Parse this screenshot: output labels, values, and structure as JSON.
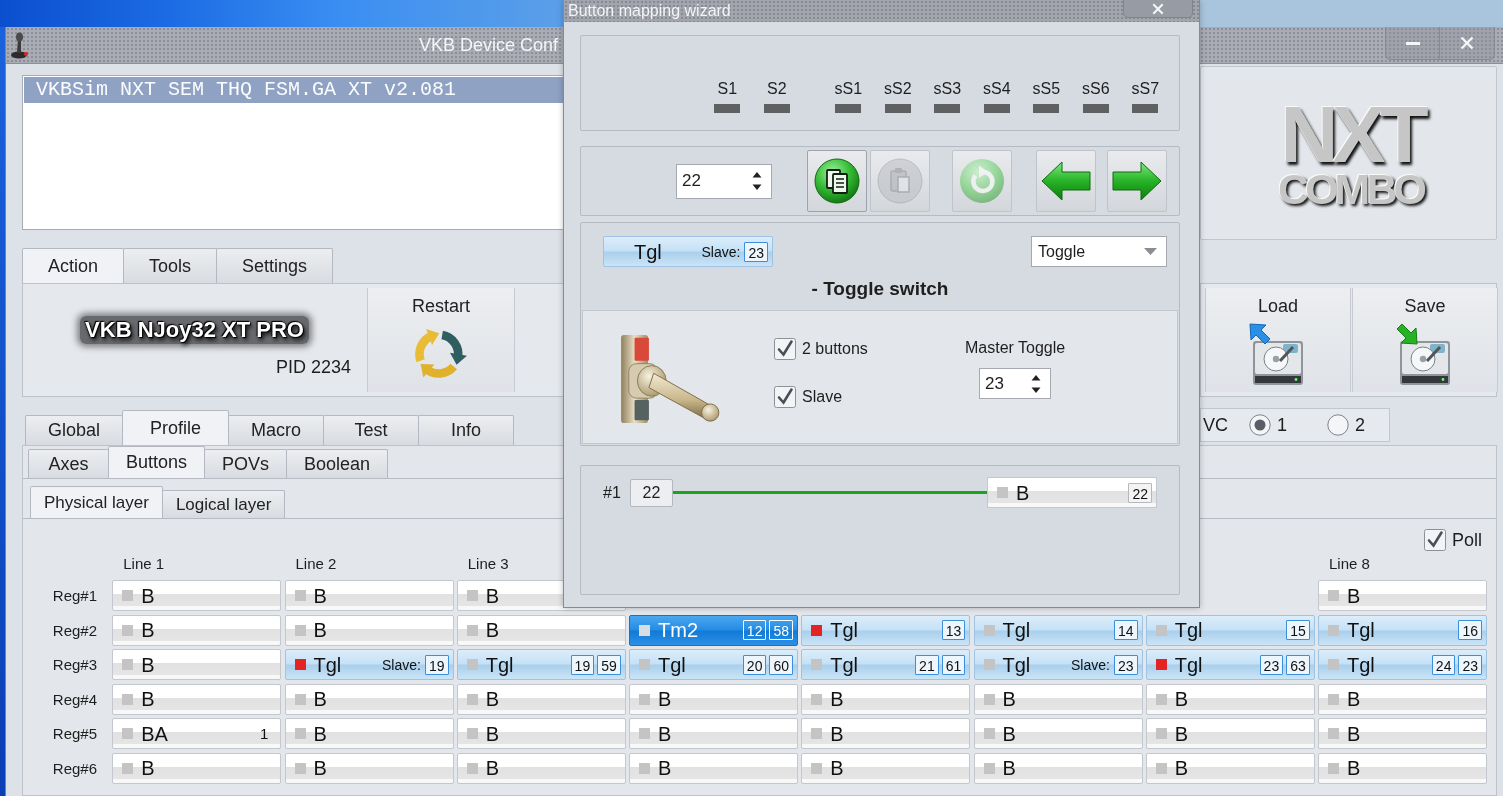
{
  "main_window": {
    "title": "VKB Device Conf"
  },
  "device_list": {
    "items": [
      {
        "label": "VKBSim NXT SEM THQ FSM.GA XT v2.081",
        "selected": true
      }
    ]
  },
  "logo": {
    "title": "NXT",
    "subtitle": "COMBO"
  },
  "action_tabs": [
    {
      "label": "Action",
      "selected": true
    },
    {
      "label": "Tools",
      "selected": false
    },
    {
      "label": "Settings",
      "selected": false
    }
  ],
  "action_panel": {
    "device_name": "VKB NJoy32 XT PRO",
    "pid": "PID 2234",
    "buttons": [
      {
        "kind": "restart",
        "label": "Restart"
      }
    ],
    "file_buttons": [
      {
        "kind": "load",
        "label": "Load"
      },
      {
        "kind": "save",
        "label": "Save"
      }
    ]
  },
  "profile_tabs": [
    {
      "label": "Global",
      "selected": false
    },
    {
      "label": "Profile",
      "selected": true
    },
    {
      "label": "Macro",
      "selected": false
    },
    {
      "label": "Test",
      "selected": false
    },
    {
      "label": "Info",
      "selected": false
    }
  ],
  "vc_group": {
    "label": "VC",
    "options": [
      {
        "label": "1",
        "selected": true
      },
      {
        "label": "2",
        "selected": false
      }
    ]
  },
  "profile_subtabs": [
    {
      "label": "Axes",
      "selected": false
    },
    {
      "label": "Buttons",
      "selected": true
    },
    {
      "label": "POVs",
      "selected": false
    },
    {
      "label": "Boolean",
      "selected": false
    }
  ],
  "layer_tabs": [
    {
      "label": "Physical layer",
      "selected": true
    },
    {
      "label": "Logical layer",
      "selected": false
    }
  ],
  "grid": {
    "poll": {
      "label": "Poll",
      "checked": true
    },
    "columns": [
      {
        "kind": "header",
        "label": "Line 1"
      },
      {
        "kind": "header",
        "label": "Line 2"
      },
      {
        "kind": "header",
        "label": "Line 3"
      },
      {
        "kind": "covered"
      },
      {
        "kind": "covered"
      },
      {
        "kind": "covered"
      },
      {
        "kind": "covered"
      },
      {
        "kind": "header",
        "label": "Line 8"
      }
    ],
    "rows": [
      {
        "label": "Reg#1",
        "cells": [
          {
            "kind": "plain",
            "label": "B",
            "on": false
          },
          {
            "kind": "plain",
            "label": "B",
            "on": false
          },
          {
            "kind": "plain",
            "label": "B",
            "on": false
          },
          {
            "kind": "covered"
          },
          {
            "kind": "covered"
          },
          {
            "kind": "covered"
          },
          {
            "kind": "covered"
          },
          {
            "kind": "plain",
            "label": "B",
            "on": false
          }
        ]
      },
      {
        "label": "Reg#2",
        "cells": [
          {
            "kind": "plain",
            "label": "B",
            "on": false
          },
          {
            "kind": "plain",
            "label": "B",
            "on": false
          },
          {
            "kind": "plain",
            "label": "B",
            "on": false
          },
          {
            "kind": "tempo",
            "label": "Tm2",
            "on": false,
            "numbers": [
              "12",
              "58"
            ]
          },
          {
            "kind": "toggle",
            "label": "Tgl",
            "on": true,
            "numbers": [
              "13"
            ]
          },
          {
            "kind": "toggle",
            "label": "Tgl",
            "on": false,
            "numbers": [
              "14"
            ]
          },
          {
            "kind": "toggle",
            "label": "Tgl",
            "on": false,
            "numbers": [
              "15"
            ]
          },
          {
            "kind": "toggle",
            "label": "Tgl",
            "on": false,
            "numbers": [
              "16"
            ]
          }
        ]
      },
      {
        "label": "Reg#3",
        "cells": [
          {
            "kind": "plain",
            "label": "B",
            "on": false
          },
          {
            "kind": "toggle",
            "label": "Tgl",
            "on": true,
            "tag": "Slave:",
            "numbers": [
              "19"
            ]
          },
          {
            "kind": "toggle",
            "label": "Tgl",
            "on": false,
            "numbers": [
              "19",
              "59"
            ]
          },
          {
            "kind": "toggle",
            "label": "Tgl",
            "on": false,
            "numbers": [
              "20",
              "60"
            ]
          },
          {
            "kind": "toggle",
            "label": "Tgl",
            "on": false,
            "numbers": [
              "21",
              "61"
            ]
          },
          {
            "kind": "toggle",
            "label": "Tgl",
            "on": false,
            "tag": "Slave:",
            "numbers": [
              "23"
            ]
          },
          {
            "kind": "toggle",
            "label": "Tgl",
            "on": true,
            "numbers": [
              "23",
              "63"
            ]
          },
          {
            "kind": "toggle",
            "label": "Tgl",
            "on": false,
            "numbers": [
              "24",
              "23"
            ]
          }
        ]
      },
      {
        "label": "Reg#4",
        "cells": [
          {
            "kind": "plain",
            "label": "B",
            "on": false
          },
          {
            "kind": "plain",
            "label": "B",
            "on": false
          },
          {
            "kind": "plain",
            "label": "B",
            "on": false
          },
          {
            "kind": "plain",
            "label": "B",
            "on": false
          },
          {
            "kind": "plain",
            "label": "B",
            "on": false
          },
          {
            "kind": "plain",
            "label": "B",
            "on": false
          },
          {
            "kind": "plain",
            "label": "B",
            "on": false
          },
          {
            "kind": "plain",
            "label": "B",
            "on": false
          }
        ]
      },
      {
        "label": "Reg#5",
        "cells": [
          {
            "kind": "plain",
            "label": "BA",
            "on": false,
            "note": "1"
          },
          {
            "kind": "plain",
            "label": "B",
            "on": false
          },
          {
            "kind": "plain",
            "label": "B",
            "on": false
          },
          {
            "kind": "plain",
            "label": "B",
            "on": false
          },
          {
            "kind": "plain",
            "label": "B",
            "on": false
          },
          {
            "kind": "plain",
            "label": "B",
            "on": false
          },
          {
            "kind": "plain",
            "label": "B",
            "on": false
          },
          {
            "kind": "plain",
            "label": "B",
            "on": false
          }
        ]
      },
      {
        "label": "Reg#6",
        "cells": [
          {
            "kind": "plain",
            "label": "B",
            "on": false
          },
          {
            "kind": "plain",
            "label": "B",
            "on": false
          },
          {
            "kind": "plain",
            "label": "B",
            "on": false
          },
          {
            "kind": "plain",
            "label": "B",
            "on": false
          },
          {
            "kind": "plain",
            "label": "B",
            "on": false
          },
          {
            "kind": "plain",
            "label": "B",
            "on": false
          },
          {
            "kind": "plain",
            "label": "B",
            "on": false
          },
          {
            "kind": "plain",
            "label": "B",
            "on": false
          }
        ]
      }
    ]
  },
  "wizard": {
    "title": "Button mapping wizard",
    "switches": [
      {
        "label": "S1",
        "on": false
      },
      {
        "label": "S2",
        "on": false
      }
    ],
    "sub_switches": [
      {
        "label": "sS1",
        "on": false
      },
      {
        "label": "sS2",
        "on": false
      },
      {
        "label": "sS3",
        "on": false
      },
      {
        "label": "sS4",
        "on": false
      },
      {
        "label": "sS5",
        "on": false
      },
      {
        "label": "sS6",
        "on": false
      },
      {
        "label": "sS7",
        "on": false
      }
    ],
    "button_number": "22",
    "tools": [
      {
        "kind": "copy",
        "disabled": false
      },
      {
        "kind": "paste",
        "disabled": true
      },
      {
        "kind": "reset",
        "disabled": true
      },
      {
        "kind": "previous",
        "disabled": false
      },
      {
        "kind": "next",
        "disabled": false
      }
    ],
    "function": {
      "kind": "toggle",
      "label": "Tgl",
      "tag": "Slave:",
      "numbers": [
        "23"
      ]
    },
    "function_type": "Toggle",
    "heading": "- Toggle switch",
    "options": [
      {
        "label": "2 buttons",
        "checked": true
      },
      {
        "label": "Slave",
        "checked": true
      }
    ],
    "master": {
      "label": "Master Toggle",
      "value": "23"
    },
    "mapping": [
      {
        "label": "#1",
        "source": "22",
        "target": {
          "kind": "plain",
          "label": "B",
          "on": false,
          "numbers": [
            "22"
          ]
        }
      }
    ]
  }
}
